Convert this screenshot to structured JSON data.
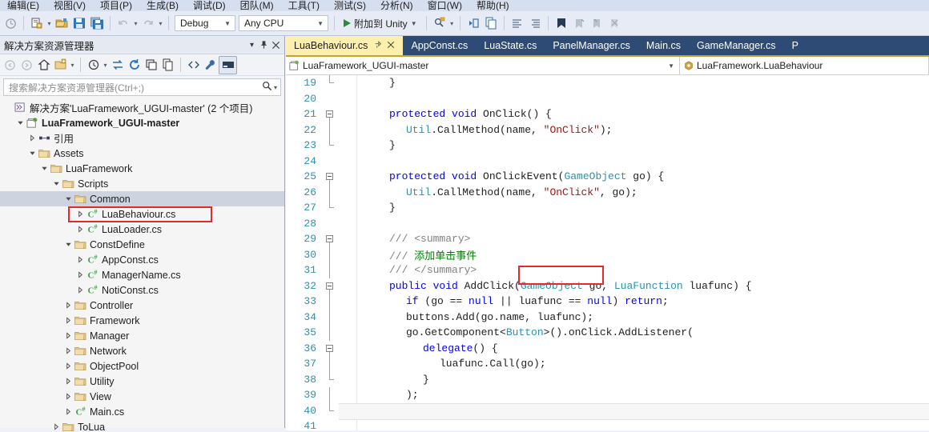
{
  "menu": {
    "items": [
      "编辑(E)",
      "视图(V)",
      "项目(P)",
      "生成(B)",
      "调试(D)",
      "团队(M)",
      "工具(T)",
      "测试(S)",
      "分析(N)",
      "窗口(W)",
      "帮助(H)"
    ]
  },
  "toolbar": {
    "config": "Debug",
    "platform": "Any CPU",
    "run_label": "附加到 Unity",
    "icons": [
      "undo-icon",
      "new-project-icon",
      "open-folder-icon",
      "save-icon",
      "save-all-icon",
      "undo-arrow-icon",
      "redo-arrow-icon",
      "start-icon",
      "find-icon",
      "step-into-icon",
      "comment-icon",
      "uncomment-icon",
      "indent-icon",
      "outdent-icon",
      "bookmark-icon",
      "prev-bookmark-icon",
      "next-bookmark-icon",
      "clear-bookmark-icon"
    ]
  },
  "solution_explorer": {
    "title": "解决方案资源管理器",
    "dropdown_icon": "chevron-down-icon",
    "pin_icon": "pin-icon",
    "close_icon": "close-icon",
    "search_placeholder": "搜索解决方案资源管理器(Ctrl+;)",
    "search_icon": "magnifier-icon",
    "tools": [
      "back-icon",
      "forward-icon",
      "home-icon",
      "switch-views-icon",
      "toolbar-caret-icon",
      "pending-changes-icon",
      "sync-icon",
      "refresh-icon",
      "collapse-all-icon",
      "show-all-files-icon",
      "code-view-icon",
      "properties-icon",
      "preview-icon"
    ],
    "tree": [
      {
        "label": "解决方案'LuaFramework_UGUI-master' (2 个项目)",
        "indent": 0,
        "expander": "none",
        "icon": "solution-icon",
        "bold": false,
        "selected": false
      },
      {
        "label": "LuaFramework_UGUI-master",
        "indent": 1,
        "expander": "expanded",
        "icon": "csharp-project-icon",
        "bold": true,
        "selected": false
      },
      {
        "label": "引用",
        "indent": 2,
        "expander": "collapsed",
        "icon": "references-icon",
        "bold": false,
        "selected": false
      },
      {
        "label": "Assets",
        "indent": 2,
        "expander": "expanded",
        "icon": "folder-icon",
        "bold": false,
        "selected": false
      },
      {
        "label": "LuaFramework",
        "indent": 3,
        "expander": "expanded",
        "icon": "folder-icon",
        "bold": false,
        "selected": false
      },
      {
        "label": "Scripts",
        "indent": 4,
        "expander": "expanded",
        "icon": "folder-icon",
        "bold": false,
        "selected": false
      },
      {
        "label": "Common",
        "indent": 5,
        "expander": "expanded",
        "icon": "folder-icon",
        "bold": false,
        "selected": true
      },
      {
        "label": "LuaBehaviour.cs",
        "indent": 6,
        "expander": "collapsed",
        "icon": "csharp-file-icon",
        "bold": false,
        "selected": false
      },
      {
        "label": "LuaLoader.cs",
        "indent": 6,
        "expander": "collapsed",
        "icon": "csharp-file-icon",
        "bold": false,
        "selected": false
      },
      {
        "label": "ConstDefine",
        "indent": 5,
        "expander": "expanded",
        "icon": "folder-icon",
        "bold": false,
        "selected": false
      },
      {
        "label": "AppConst.cs",
        "indent": 6,
        "expander": "collapsed",
        "icon": "csharp-file-icon",
        "bold": false,
        "selected": false
      },
      {
        "label": "ManagerName.cs",
        "indent": 6,
        "expander": "collapsed",
        "icon": "csharp-file-icon",
        "bold": false,
        "selected": false
      },
      {
        "label": "NotiConst.cs",
        "indent": 6,
        "expander": "collapsed",
        "icon": "csharp-file-icon",
        "bold": false,
        "selected": false
      },
      {
        "label": "Controller",
        "indent": 5,
        "expander": "collapsed",
        "icon": "folder-icon",
        "bold": false,
        "selected": false
      },
      {
        "label": "Framework",
        "indent": 5,
        "expander": "collapsed",
        "icon": "folder-icon",
        "bold": false,
        "selected": false
      },
      {
        "label": "Manager",
        "indent": 5,
        "expander": "collapsed",
        "icon": "folder-icon",
        "bold": false,
        "selected": false
      },
      {
        "label": "Network",
        "indent": 5,
        "expander": "collapsed",
        "icon": "folder-icon",
        "bold": false,
        "selected": false
      },
      {
        "label": "ObjectPool",
        "indent": 5,
        "expander": "collapsed",
        "icon": "folder-icon",
        "bold": false,
        "selected": false
      },
      {
        "label": "Utility",
        "indent": 5,
        "expander": "collapsed",
        "icon": "folder-icon",
        "bold": false,
        "selected": false
      },
      {
        "label": "View",
        "indent": 5,
        "expander": "collapsed",
        "icon": "folder-icon",
        "bold": false,
        "selected": false
      },
      {
        "label": "Main.cs",
        "indent": 5,
        "expander": "collapsed",
        "icon": "csharp-file-icon",
        "bold": false,
        "selected": false
      },
      {
        "label": "ToLua",
        "indent": 4,
        "expander": "collapsed",
        "icon": "folder-icon",
        "bold": false,
        "selected": false
      }
    ]
  },
  "editor": {
    "tabs": [
      {
        "label": "LuaBehaviour.cs",
        "active": true
      },
      {
        "label": "AppConst.cs",
        "active": false
      },
      {
        "label": "LuaState.cs",
        "active": false
      },
      {
        "label": "PanelManager.cs",
        "active": false
      },
      {
        "label": "Main.cs",
        "active": false
      },
      {
        "label": "GameManager.cs",
        "active": false
      },
      {
        "label": "P",
        "active": false
      }
    ],
    "tab_pin_icon": "pin-icon",
    "tab_close_icon": "close-icon",
    "nav_project": "LuaFramework_UGUI-master",
    "nav_member": "LuaFramework.LuaBehaviour",
    "nav_project_icon": "project-icon",
    "nav_member_icon": "class-icon",
    "first_line": 19,
    "lines": [
      {
        "num": 19,
        "indent": 3,
        "fold": "end",
        "tokens": [
          {
            "t": "}",
            "c": "n"
          }
        ]
      },
      {
        "num": 20,
        "indent": 0,
        "fold": "none",
        "tokens": []
      },
      {
        "num": 21,
        "indent": 3,
        "fold": "start",
        "tokens": [
          {
            "t": "protected void ",
            "c": "k"
          },
          {
            "t": "OnClick() {",
            "c": "n"
          }
        ]
      },
      {
        "num": 22,
        "indent": 4,
        "fold": "none",
        "tokens": [
          {
            "t": "Util",
            "c": "t"
          },
          {
            "t": ".CallMethod(name, ",
            "c": "n"
          },
          {
            "t": "\"OnClick\"",
            "c": "s"
          },
          {
            "t": ");",
            "c": "n"
          }
        ]
      },
      {
        "num": 23,
        "indent": 3,
        "fold": "end",
        "tokens": [
          {
            "t": "}",
            "c": "n"
          }
        ]
      },
      {
        "num": 24,
        "indent": 0,
        "fold": "none",
        "tokens": []
      },
      {
        "num": 25,
        "indent": 3,
        "fold": "start",
        "tokens": [
          {
            "t": "protected void ",
            "c": "k"
          },
          {
            "t": "OnClickEvent(",
            "c": "n"
          },
          {
            "t": "GameObject",
            "c": "t"
          },
          {
            "t": " go) {",
            "c": "n"
          }
        ]
      },
      {
        "num": 26,
        "indent": 4,
        "fold": "none",
        "tokens": [
          {
            "t": "Util",
            "c": "t"
          },
          {
            "t": ".CallMethod(name, ",
            "c": "n"
          },
          {
            "t": "\"OnClick\"",
            "c": "s"
          },
          {
            "t": ", go);",
            "c": "n"
          }
        ]
      },
      {
        "num": 27,
        "indent": 3,
        "fold": "end",
        "tokens": [
          {
            "t": "}",
            "c": "n"
          }
        ]
      },
      {
        "num": 28,
        "indent": 0,
        "fold": "none",
        "tokens": []
      },
      {
        "num": 29,
        "indent": 3,
        "fold": "start",
        "tokens": [
          {
            "t": "/// ",
            "c": "cg"
          },
          {
            "t": "<summary>",
            "c": "cg"
          }
        ]
      },
      {
        "num": 30,
        "indent": 3,
        "fold": "none",
        "tokens": [
          {
            "t": "/// ",
            "c": "cg"
          },
          {
            "t": "添加单击事件",
            "c": "c"
          }
        ]
      },
      {
        "num": 31,
        "indent": 3,
        "fold": "none",
        "tokens": [
          {
            "t": "/// ",
            "c": "cg"
          },
          {
            "t": "</summary>",
            "c": "cg"
          }
        ]
      },
      {
        "num": 32,
        "indent": 3,
        "fold": "start",
        "tokens": [
          {
            "t": "public void ",
            "c": "k"
          },
          {
            "t": "AddClick(",
            "c": "n"
          },
          {
            "t": "GameObject",
            "c": "t"
          },
          {
            "t": " go, ",
            "c": "n"
          },
          {
            "t": "LuaFunction",
            "c": "t"
          },
          {
            "t": " luafunc) {",
            "c": "n"
          }
        ]
      },
      {
        "num": 33,
        "indent": 4,
        "fold": "none",
        "tokens": [
          {
            "t": "if ",
            "c": "k"
          },
          {
            "t": "(go == ",
            "c": "n"
          },
          {
            "t": "null",
            "c": "k"
          },
          {
            "t": " || luafunc == ",
            "c": "n"
          },
          {
            "t": "null",
            "c": "k"
          },
          {
            "t": ") ",
            "c": "n"
          },
          {
            "t": "return",
            "c": "k"
          },
          {
            "t": ";",
            "c": "n"
          }
        ]
      },
      {
        "num": 34,
        "indent": 4,
        "fold": "none",
        "tokens": [
          {
            "t": "buttons.Add(go.name, luafunc);",
            "c": "n"
          }
        ]
      },
      {
        "num": 35,
        "indent": 4,
        "fold": "none",
        "tokens": [
          {
            "t": "go.GetComponent<",
            "c": "n"
          },
          {
            "t": "Button",
            "c": "t"
          },
          {
            "t": ">().onClick.AddListener(",
            "c": "n"
          }
        ]
      },
      {
        "num": 36,
        "indent": 5,
        "fold": "start",
        "tokens": [
          {
            "t": "delegate",
            "c": "k"
          },
          {
            "t": "() {",
            "c": "n"
          }
        ]
      },
      {
        "num": 37,
        "indent": 6,
        "fold": "none",
        "tokens": [
          {
            "t": "luafunc.Call(go);",
            "c": "n"
          }
        ]
      },
      {
        "num": 38,
        "indent": 5,
        "fold": "end",
        "tokens": [
          {
            "t": "}",
            "c": "n"
          }
        ]
      },
      {
        "num": 39,
        "indent": 4,
        "fold": "none",
        "tokens": [
          {
            "t": ");",
            "c": "n"
          }
        ]
      },
      {
        "num": 40,
        "indent": 3,
        "fold": "end",
        "tokens": [
          {
            "t": "}",
            "c": "n"
          }
        ]
      },
      {
        "num": 41,
        "indent": 0,
        "fold": "none",
        "tokens": []
      }
    ]
  },
  "annotations": {
    "highlight_color": "#e02b2b",
    "boxes": [
      "lua-behaviour-tree-item",
      "add-click-method-name"
    ]
  }
}
